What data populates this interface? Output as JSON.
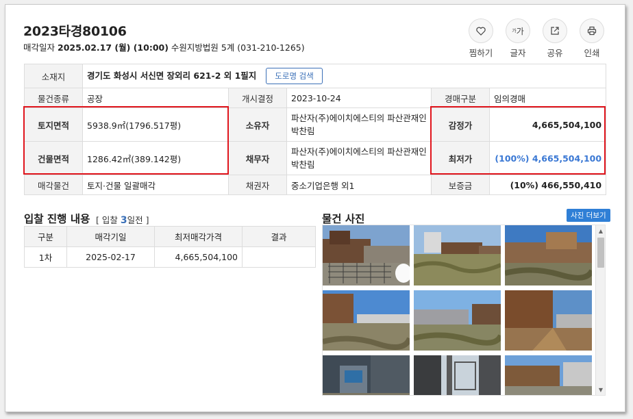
{
  "header": {
    "case_no": "2023타경80106",
    "sale_label": "매각일자",
    "sale_date": "2025.02.17 (월) (10:00)",
    "court": "수원지방법원 5계 (031-210-1265)"
  },
  "actions": [
    {
      "label": "찜하기",
      "icon": "heart-icon",
      "glyph": "♡"
    },
    {
      "label": "글자",
      "icon": "font-size-icon",
      "glyph": "ᵍ가"
    },
    {
      "label": "공유",
      "icon": "share-icon",
      "glyph": "⇱"
    },
    {
      "label": "인쇄",
      "icon": "print-icon",
      "glyph": "⎙"
    }
  ],
  "info": {
    "location_label": "소재지",
    "location": "경기도 화성시 서신면 장외리 621-2 외 1필지",
    "road_button": "도로명 검색",
    "type_label": "물건종류",
    "type": "공장",
    "start_label": "개시결정",
    "start": "2023-10-24",
    "auction_type_label": "경매구분",
    "auction_type": "임의경매",
    "land_label": "토지면적",
    "land": "5938.9㎡(1796.517평)",
    "owner_label": "소유자",
    "owner": "파산자(주)에이치에스티의 파산관재인 박찬림",
    "appraisal_label": "감정가",
    "appraisal": "4,665,504,100",
    "building_label": "건물면적",
    "building": "1286.42㎡(389.142평)",
    "debtor_label": "채무자",
    "debtor": "파산자(주)에이치에스티의 파산관재인 박찬림",
    "min_label": "최저가",
    "min": "(100%) 4,665,504,100",
    "sale_item_label": "매각물건",
    "sale_item": "토지·건물 일괄매각",
    "creditor_label": "채권자",
    "creditor": "중소기업은행 외1",
    "deposit_label": "보증금",
    "deposit": "(10%) 466,550,410"
  },
  "bids": {
    "title": "입찰 진행 내용",
    "sub_prefix": "[ 입찰",
    "days": "3",
    "sub_suffix": "일전 ]",
    "headers": [
      "구분",
      "매각기일",
      "최저매각가격",
      "결과"
    ],
    "rows": [
      {
        "round": "1차",
        "date": "2025-02-17",
        "price": "4,665,504,100",
        "result": ""
      }
    ]
  },
  "photos": {
    "title": "물건 사진",
    "more_button": "사진 더보기"
  },
  "colors": {
    "accent": "#3a6fb7",
    "highlight_red": "#e0141c",
    "min_price_blue": "#3a78d4",
    "header_bg": "#f3f3f3"
  }
}
